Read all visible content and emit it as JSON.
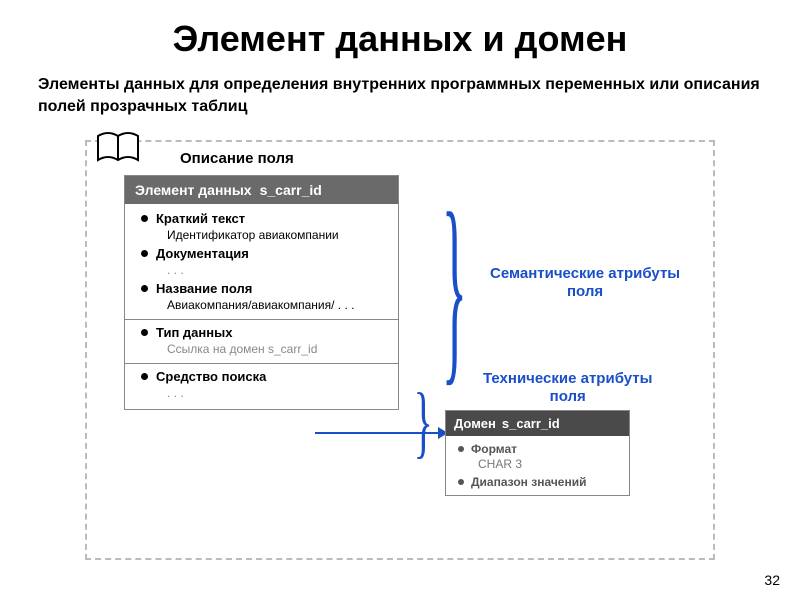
{
  "title": "Элемент данных и домен",
  "subtitle": "Элементы данных для определения внутренних программных переменных или описания полей прозрачных таблиц",
  "field_desc_label": "Описание поля",
  "de_header_prefix": "Элемент данных",
  "de_header_name": "s_carr_id",
  "de_items": {
    "short_text": {
      "label": "Краткий текст",
      "sub": "Идентификатор авиакомпании"
    },
    "documentation": {
      "label": "Документация",
      "sub": ". . ."
    },
    "field_name": {
      "label": "Название поля",
      "sub": "Авиакомпания/авиакомпания/ . . ."
    },
    "data_type": {
      "label": "Тип данных",
      "sub": "Ссылка на домен  s_carr_id"
    },
    "search_help": {
      "label": "Средство поиска",
      "sub": ". . ."
    }
  },
  "callout1": "Семантические атрибуты поля",
  "callout2": "Технические атрибуты поля",
  "dm_header_prefix": "Домен",
  "dm_header_name": "s_carr_id",
  "dm_items": {
    "format": {
      "label": "Формат",
      "sub": "CHAR  3"
    },
    "range": {
      "label": "Диапазон значений"
    }
  },
  "page_number": "32"
}
